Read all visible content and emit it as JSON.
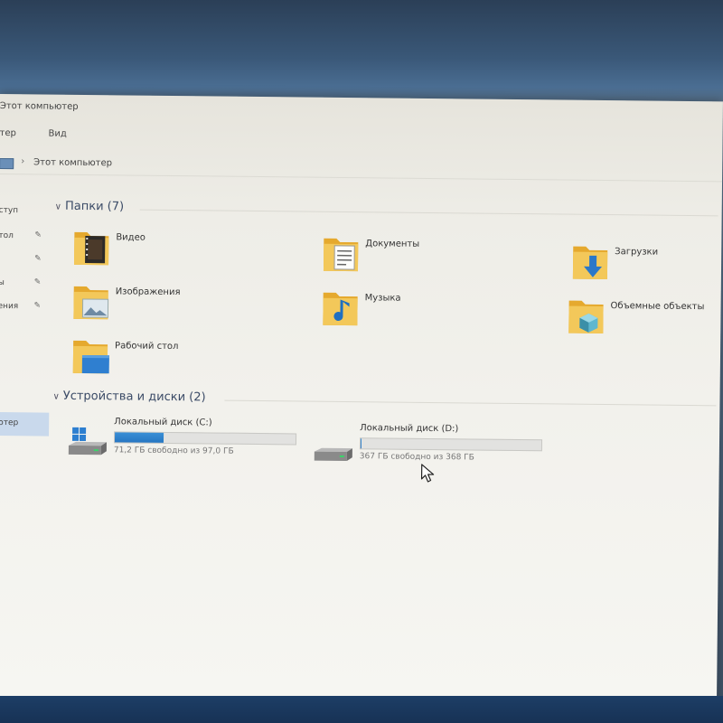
{
  "window": {
    "title": "Этот компьютер"
  },
  "menu": {
    "items": [
      "тер",
      "Вид"
    ]
  },
  "address": {
    "path": "Этот компьютер"
  },
  "nav": {
    "items": [
      {
        "label": "ступ",
        "pinned": false
      },
      {
        "label": "тол",
        "pinned": true
      },
      {
        "label": "",
        "pinned": true
      },
      {
        "label": "ы",
        "pinned": true
      },
      {
        "label": "ения",
        "pinned": true
      }
    ],
    "selected": "ютер"
  },
  "folders_group": {
    "header": "Папки (7)",
    "items": [
      {
        "label": "Видео",
        "icon": "video-folder-icon"
      },
      {
        "label": "Документы",
        "icon": "documents-folder-icon"
      },
      {
        "label": "Загрузки",
        "icon": "downloads-folder-icon"
      },
      {
        "label": "Изображения",
        "icon": "pictures-folder-icon"
      },
      {
        "label": "Музыка",
        "icon": "music-folder-icon"
      },
      {
        "label": "Объемные объекты",
        "icon": "3d-objects-folder-icon"
      },
      {
        "label": "Рабочий стол",
        "icon": "desktop-folder-icon"
      }
    ]
  },
  "drives_group": {
    "header": "Устройства и диски (2)",
    "items": [
      {
        "label": "Локальный диск (C:)",
        "free_text": "71,2 ГБ свободно из 97,0 ГБ",
        "used_fraction": 0.27,
        "icon": "windows-drive-icon"
      },
      {
        "label": "Локальный диск (D:)",
        "free_text": "367 ГБ свободно из 368 ГБ",
        "used_fraction": 0.003,
        "icon": "hard-drive-icon"
      }
    ]
  },
  "colors": {
    "accent": "#2676c2",
    "selection": "#c9d9ec",
    "folder": "#f0c14b"
  }
}
